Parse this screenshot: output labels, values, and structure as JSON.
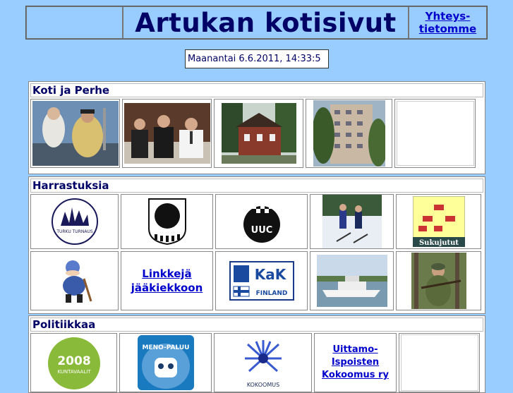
{
  "header": {
    "title": "Artukan kotisivut",
    "contact_line1": "Yhteys-",
    "contact_line2": "tietomme"
  },
  "clock": "Maanantai 6.6.2011, 14:33:5",
  "sections": {
    "home": {
      "title": "Koti ja Perhe"
    },
    "hobbies": {
      "title": "Harrastuksia",
      "hockey_link_line1": "Linkkejä",
      "hockey_link_line2": "jääkiekkoon",
      "turku_logo_text": "TURKU TURNAUS",
      "kak_logo_text": "KaK",
      "kak_logo_sub": "FINLAND",
      "suku_text": "Sukujutut",
      "uuc_text": "UUC"
    },
    "politics": {
      "title": "Politiikkaa",
      "party_link_line1": "Uittamo-",
      "party_link_line2": "Ispoisten",
      "party_link_line3": "Kokoomus ry",
      "badge_2008_text": "2008",
      "badge_2008_sub": "KUNTAVAALIT",
      "menopaluu_text": "MENO-PALUU",
      "kokoomus_text": "KOKOOMUS"
    }
  }
}
